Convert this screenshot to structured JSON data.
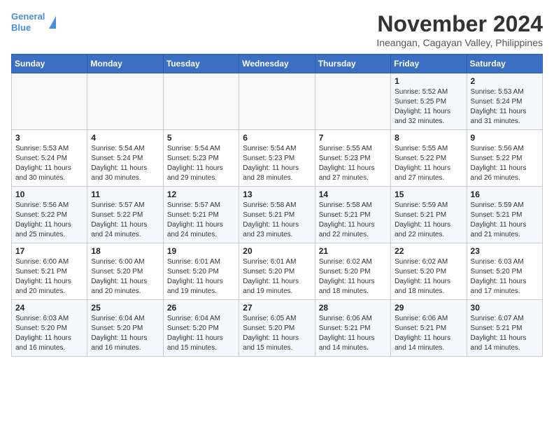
{
  "header": {
    "logo_line1": "General",
    "logo_line2": "Blue",
    "month": "November 2024",
    "location": "Ineangan, Cagayan Valley, Philippines"
  },
  "weekdays": [
    "Sunday",
    "Monday",
    "Tuesday",
    "Wednesday",
    "Thursday",
    "Friday",
    "Saturday"
  ],
  "weeks": [
    [
      {
        "day": "",
        "info": ""
      },
      {
        "day": "",
        "info": ""
      },
      {
        "day": "",
        "info": ""
      },
      {
        "day": "",
        "info": ""
      },
      {
        "day": "",
        "info": ""
      },
      {
        "day": "1",
        "info": "Sunrise: 5:52 AM\nSunset: 5:25 PM\nDaylight: 11 hours\nand 32 minutes."
      },
      {
        "day": "2",
        "info": "Sunrise: 5:53 AM\nSunset: 5:24 PM\nDaylight: 11 hours\nand 31 minutes."
      }
    ],
    [
      {
        "day": "3",
        "info": "Sunrise: 5:53 AM\nSunset: 5:24 PM\nDaylight: 11 hours\nand 30 minutes."
      },
      {
        "day": "4",
        "info": "Sunrise: 5:54 AM\nSunset: 5:24 PM\nDaylight: 11 hours\nand 30 minutes."
      },
      {
        "day": "5",
        "info": "Sunrise: 5:54 AM\nSunset: 5:23 PM\nDaylight: 11 hours\nand 29 minutes."
      },
      {
        "day": "6",
        "info": "Sunrise: 5:54 AM\nSunset: 5:23 PM\nDaylight: 11 hours\nand 28 minutes."
      },
      {
        "day": "7",
        "info": "Sunrise: 5:55 AM\nSunset: 5:23 PM\nDaylight: 11 hours\nand 27 minutes."
      },
      {
        "day": "8",
        "info": "Sunrise: 5:55 AM\nSunset: 5:22 PM\nDaylight: 11 hours\nand 27 minutes."
      },
      {
        "day": "9",
        "info": "Sunrise: 5:56 AM\nSunset: 5:22 PM\nDaylight: 11 hours\nand 26 minutes."
      }
    ],
    [
      {
        "day": "10",
        "info": "Sunrise: 5:56 AM\nSunset: 5:22 PM\nDaylight: 11 hours\nand 25 minutes."
      },
      {
        "day": "11",
        "info": "Sunrise: 5:57 AM\nSunset: 5:22 PM\nDaylight: 11 hours\nand 24 minutes."
      },
      {
        "day": "12",
        "info": "Sunrise: 5:57 AM\nSunset: 5:21 PM\nDaylight: 11 hours\nand 24 minutes."
      },
      {
        "day": "13",
        "info": "Sunrise: 5:58 AM\nSunset: 5:21 PM\nDaylight: 11 hours\nand 23 minutes."
      },
      {
        "day": "14",
        "info": "Sunrise: 5:58 AM\nSunset: 5:21 PM\nDaylight: 11 hours\nand 22 minutes."
      },
      {
        "day": "15",
        "info": "Sunrise: 5:59 AM\nSunset: 5:21 PM\nDaylight: 11 hours\nand 22 minutes."
      },
      {
        "day": "16",
        "info": "Sunrise: 5:59 AM\nSunset: 5:21 PM\nDaylight: 11 hours\nand 21 minutes."
      }
    ],
    [
      {
        "day": "17",
        "info": "Sunrise: 6:00 AM\nSunset: 5:21 PM\nDaylight: 11 hours\nand 20 minutes."
      },
      {
        "day": "18",
        "info": "Sunrise: 6:00 AM\nSunset: 5:20 PM\nDaylight: 11 hours\nand 20 minutes."
      },
      {
        "day": "19",
        "info": "Sunrise: 6:01 AM\nSunset: 5:20 PM\nDaylight: 11 hours\nand 19 minutes."
      },
      {
        "day": "20",
        "info": "Sunrise: 6:01 AM\nSunset: 5:20 PM\nDaylight: 11 hours\nand 19 minutes."
      },
      {
        "day": "21",
        "info": "Sunrise: 6:02 AM\nSunset: 5:20 PM\nDaylight: 11 hours\nand 18 minutes."
      },
      {
        "day": "22",
        "info": "Sunrise: 6:02 AM\nSunset: 5:20 PM\nDaylight: 11 hours\nand 18 minutes."
      },
      {
        "day": "23",
        "info": "Sunrise: 6:03 AM\nSunset: 5:20 PM\nDaylight: 11 hours\nand 17 minutes."
      }
    ],
    [
      {
        "day": "24",
        "info": "Sunrise: 6:03 AM\nSunset: 5:20 PM\nDaylight: 11 hours\nand 16 minutes."
      },
      {
        "day": "25",
        "info": "Sunrise: 6:04 AM\nSunset: 5:20 PM\nDaylight: 11 hours\nand 16 minutes."
      },
      {
        "day": "26",
        "info": "Sunrise: 6:04 AM\nSunset: 5:20 PM\nDaylight: 11 hours\nand 15 minutes."
      },
      {
        "day": "27",
        "info": "Sunrise: 6:05 AM\nSunset: 5:20 PM\nDaylight: 11 hours\nand 15 minutes."
      },
      {
        "day": "28",
        "info": "Sunrise: 6:06 AM\nSunset: 5:21 PM\nDaylight: 11 hours\nand 14 minutes."
      },
      {
        "day": "29",
        "info": "Sunrise: 6:06 AM\nSunset: 5:21 PM\nDaylight: 11 hours\nand 14 minutes."
      },
      {
        "day": "30",
        "info": "Sunrise: 6:07 AM\nSunset: 5:21 PM\nDaylight: 11 hours\nand 14 minutes."
      }
    ]
  ]
}
